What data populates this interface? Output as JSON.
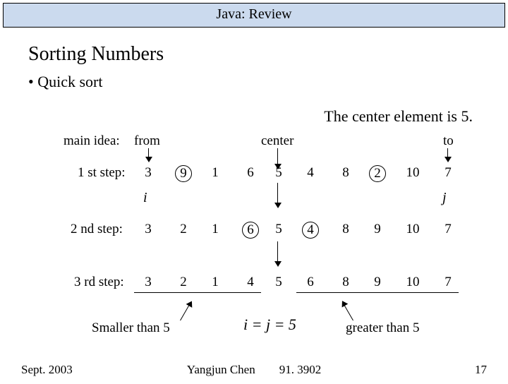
{
  "title": "Java: Review",
  "heading": "Sorting Numbers",
  "bullet": "•  Quick sort",
  "centerStatement": "The center element is 5.",
  "labels": {
    "mainIdea": "main idea:",
    "from": "from",
    "center": "center",
    "to": "to",
    "step1": "1 st step:",
    "step2": "2 nd step:",
    "step3": "3 rd step:",
    "i": "i",
    "j": "j",
    "smaller": "Smaller than 5",
    "greater": "greater than 5",
    "eq": "i = j = 5"
  },
  "rows": {
    "r1": [
      "3",
      "9",
      "1",
      "6",
      "5",
      "4",
      "8",
      "2",
      "10",
      "7"
    ],
    "r2": [
      "3",
      "2",
      "1",
      "6",
      "5",
      "4",
      "8",
      "9",
      "10",
      "7"
    ],
    "r3": [
      "3",
      "2",
      "1",
      "4",
      "5",
      "6",
      "8",
      "9",
      "10",
      "7"
    ]
  },
  "circled": {
    "r1": [
      1,
      7
    ],
    "r2": [
      3,
      5
    ]
  },
  "footer": {
    "left": "Sept. 2003",
    "midA": "Yangjun Chen",
    "midB": "91. 3902",
    "right": "17"
  }
}
